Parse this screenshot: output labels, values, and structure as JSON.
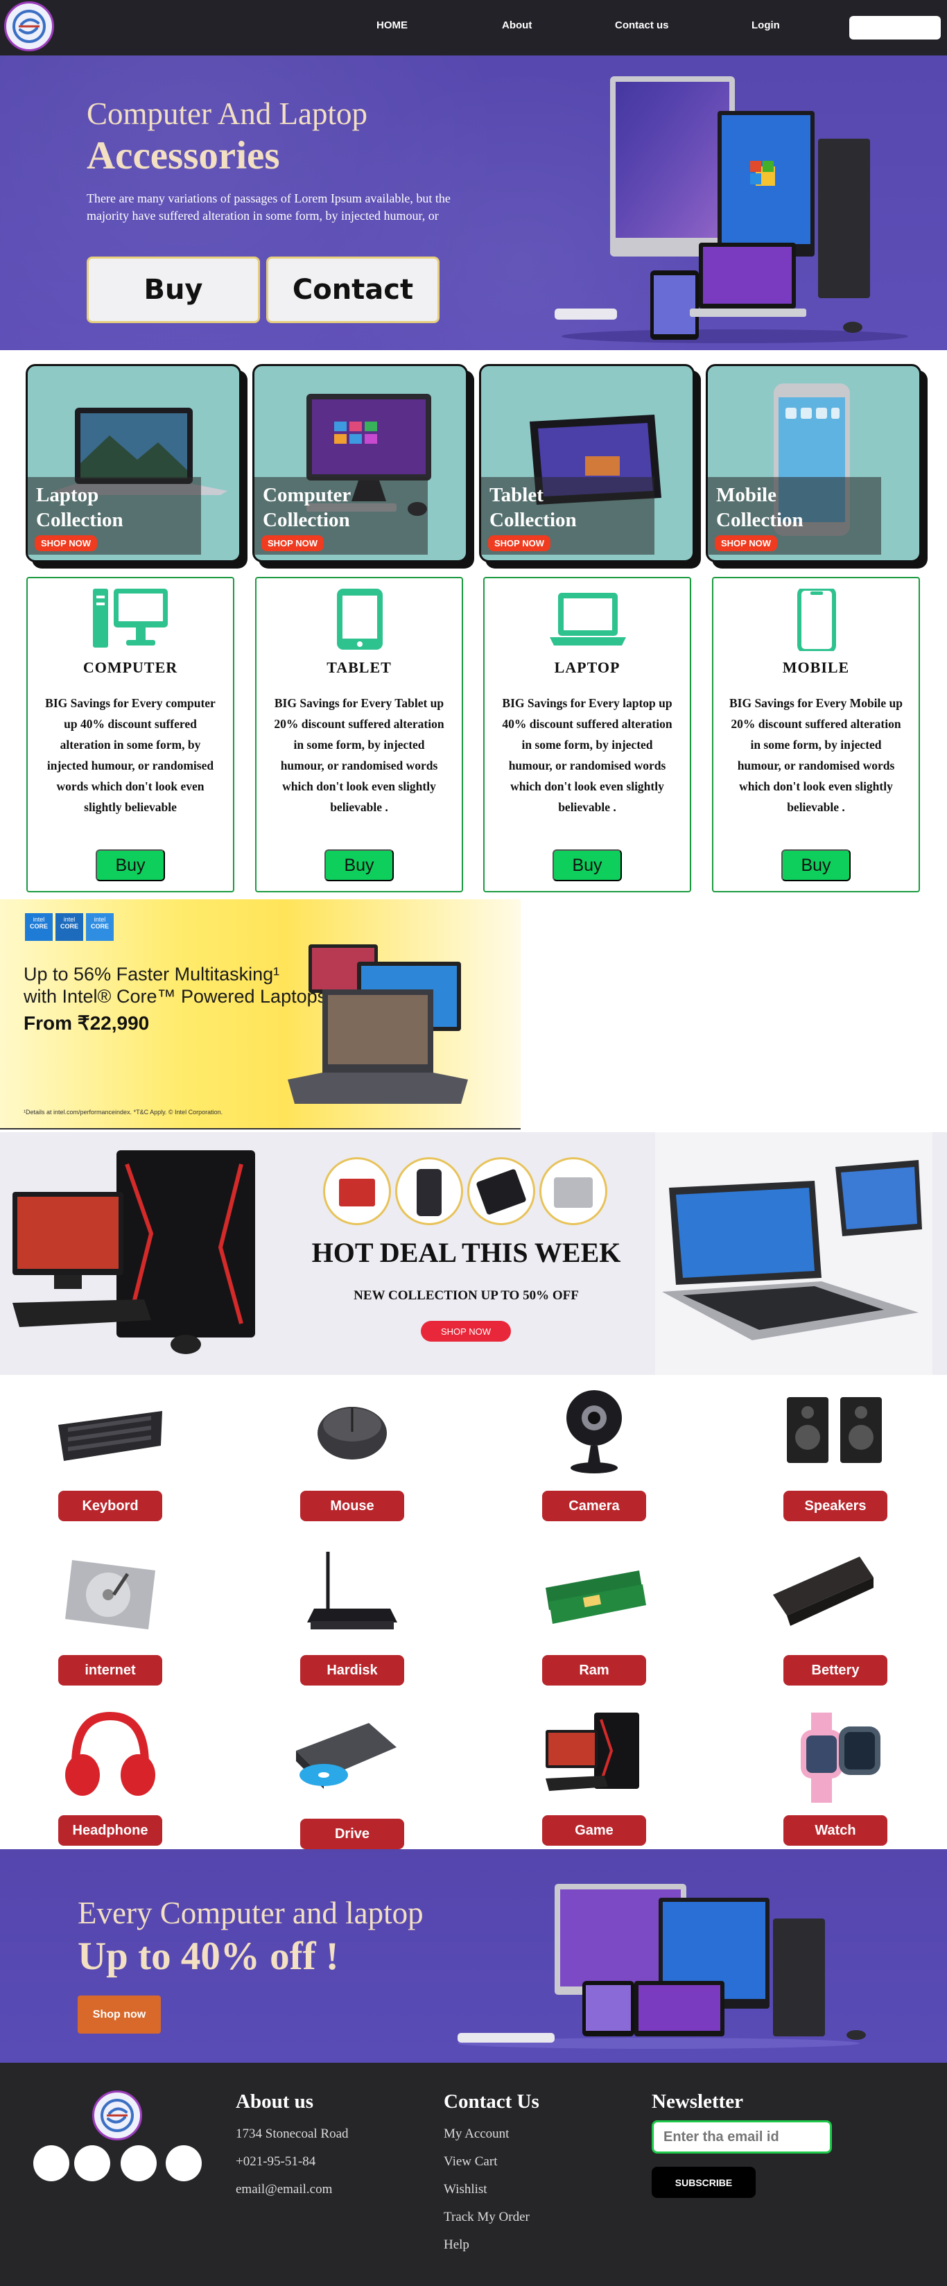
{
  "nav": {
    "links": [
      "HOME",
      "About",
      "Contact us",
      "Login"
    ]
  },
  "hero": {
    "title_line1": "Computer And Laptop",
    "title_line2": "Accessories",
    "description": "There are many variations of passages of Lorem Ipsum available, but the majority have suffered alteration in some form, by injected humour, or",
    "buy_label": "Buy",
    "contact_label": "Contact"
  },
  "collections": [
    {
      "line1": "Laptop",
      "line2": "Collection",
      "button": "SHOP NOW"
    },
    {
      "line1": "Computer",
      "line2": "Collection",
      "button": "SHOP NOW"
    },
    {
      "line1": "Tablet",
      "line2": "Collection",
      "button": "SHOP NOW"
    },
    {
      "line1": "Mobile",
      "line2": "Collection",
      "button": "SHOP NOW"
    }
  ],
  "categories": [
    {
      "name": "COMPUTER",
      "icon": "desktop-computer-icon",
      "description": "BIG Savings for Every computer up 40% discount suffered alteration in some form, by injected humour, or randomised words which don't look even slightly believable",
      "button": "Buy"
    },
    {
      "name": "TABLET",
      "icon": "tablet-icon",
      "description": "BIG Savings for Every Tablet up 20% discount suffered alteration in some form, by injected humour, or randomised words which don't look even slightly believable .",
      "button": "Buy"
    },
    {
      "name": "LAPTOP",
      "icon": "laptop-icon",
      "description": "BIG Savings for Every laptop up 40% discount suffered alteration in some form, by injected humour, or randomised words which don't look even slightly believable .",
      "button": "Buy"
    },
    {
      "name": "MOBILE",
      "icon": "mobile-phone-icon",
      "description": "BIG Savings for Every Mobile up 20% discount suffered alteration in some form, by injected humour, or randomised words which don't look even slightly believable .",
      "button": "Buy"
    }
  ],
  "intel_banner": {
    "badge_brand": "intel",
    "badge_label": "CORE",
    "headline_line1": "Up to 56% Faster Multitasking¹",
    "headline_line2": "with Intel® Core™ Powered Laptops",
    "price": "From ₹22,990",
    "footnote": "¹Details at intel.com/performanceindex. *T&C Apply. © Intel Corporation."
  },
  "hot_deal": {
    "title": "HOT DEAL THIS WEEK",
    "subtitle": "NEW COLLECTION UP TO 50% OFF",
    "button": "SHOP NOW"
  },
  "products": [
    "Keybord",
    "Mouse",
    "Camera",
    "Speakers",
    "internet",
    "Hardisk",
    "Ram",
    "Bettery",
    "Headphone",
    "Drive",
    "Game",
    "Watch"
  ],
  "promo": {
    "line1": "Every Computer and laptop",
    "line2": "Up to 40% off !",
    "button": "Shop now"
  },
  "footer": {
    "about_heading": "About us",
    "address": "1734 Stonecoal Road",
    "phone": "+021-95-51-84",
    "email": "email@email.com",
    "contact_heading": "Contact Us",
    "contact_links": [
      "My Account",
      "View Cart",
      "Wishlist",
      "Track My Order",
      "Help"
    ],
    "newsletter_heading": "Newsletter",
    "email_placeholder": "Enter tha email id",
    "subscribe": "SUBSCRIBE"
  },
  "colors": {
    "nav_bg": "#232228",
    "hero_bg": "#5648ae",
    "buy_green": "#0fcf5c",
    "product_label_red": "#b8262c",
    "shop_now_red": "#ef3b1f",
    "promo_button": "#d8692a",
    "footer_bg": "#262528"
  }
}
